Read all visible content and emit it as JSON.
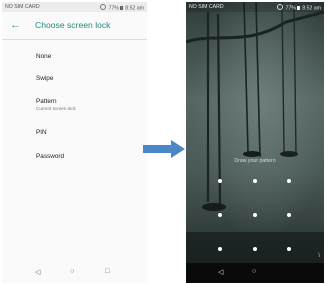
{
  "left_screen": {
    "status_bar": {
      "carrier": "NO SIM CARD",
      "battery": "77%",
      "time": "8:52 am"
    },
    "title": "Choose screen lock",
    "options": [
      {
        "label": "None",
        "subtitle": ""
      },
      {
        "label": "Swipe",
        "subtitle": ""
      },
      {
        "label": "Pattern",
        "subtitle": "Current screen lock"
      },
      {
        "label": "PIN",
        "subtitle": ""
      },
      {
        "label": "Password",
        "subtitle": ""
      }
    ],
    "nav": {
      "back": "◁",
      "home": "○",
      "recents": "□"
    }
  },
  "arrow": {
    "color": "#4a86c8"
  },
  "right_screen": {
    "status_bar": {
      "carrier": "NO SIM CARD",
      "battery": "77%",
      "time": "8:52 am"
    },
    "prompt": "Draw your pattern",
    "pattern_grid": {
      "rows": 3,
      "cols": 3
    },
    "nav": {
      "back": "◁",
      "home": "○"
    },
    "corner_glyph": "\\"
  },
  "colors": {
    "accent": "#1f8b7e",
    "back_arrow": "#2e9a8c"
  }
}
